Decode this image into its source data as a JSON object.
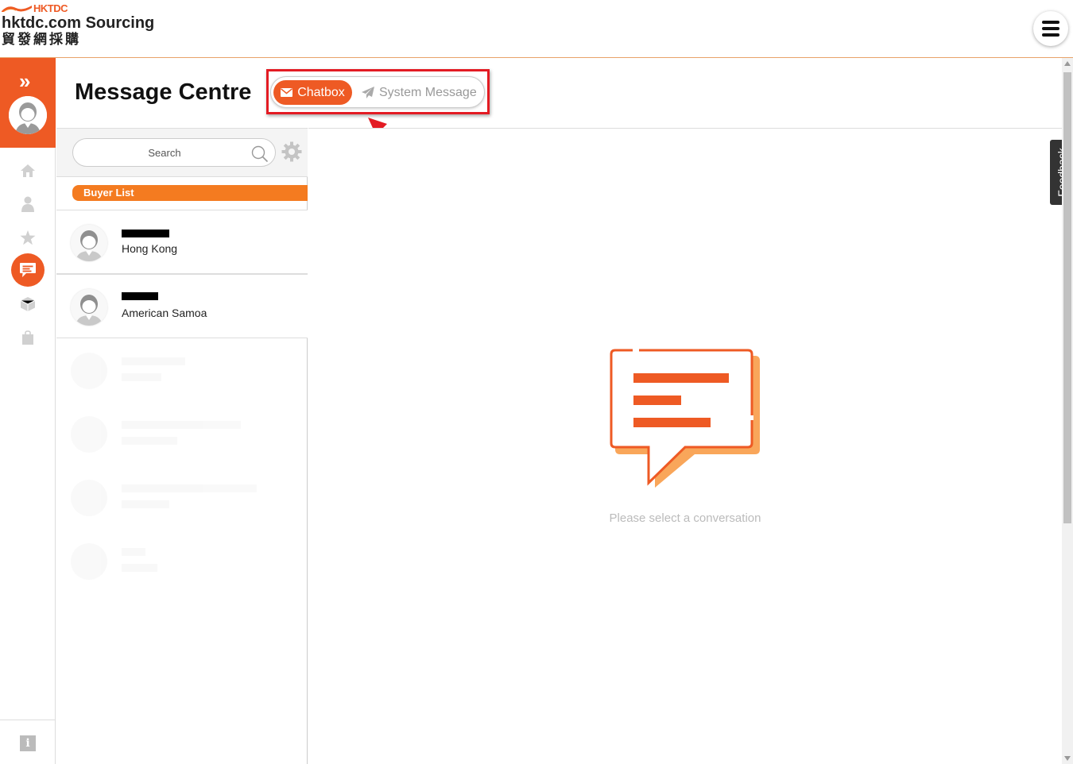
{
  "header": {
    "brand_small": "HKTDC",
    "brand_line1": "hktdc.com Sourcing",
    "brand_line2": "貿發網採購",
    "menu_icon": "hamburger-menu-icon"
  },
  "sidebar": {
    "expand_icon": "double-chevron-right-icon",
    "items": [
      {
        "icon": "home-icon"
      },
      {
        "icon": "user-icon"
      },
      {
        "icon": "star-icon"
      },
      {
        "icon": "message-icon",
        "active": true
      },
      {
        "icon": "box-icon"
      },
      {
        "icon": "shopping-bag-icon"
      }
    ],
    "info_icon": "info-icon",
    "accent_color": "#ee5a24"
  },
  "page": {
    "title": "Message Centre"
  },
  "tabs": {
    "chatbox_label": "Chatbox",
    "system_label": "System Message"
  },
  "search": {
    "placeholder": "Search"
  },
  "list": {
    "section_label": "Buyer List",
    "buyers": [
      {
        "country": "Hong Kong"
      },
      {
        "country": "American Samoa"
      }
    ]
  },
  "chat": {
    "empty_text": "Please select a conversation"
  },
  "feedback_label": "Feedback",
  "colors": {
    "accent": "#ee5a24",
    "section_orange": "#f47b20",
    "highlight_red": "#e31b23"
  }
}
